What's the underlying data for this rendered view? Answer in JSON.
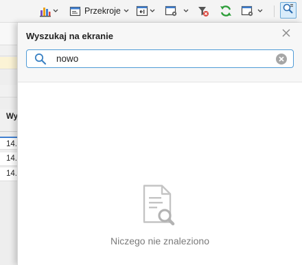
{
  "toolbar": {
    "przekroje_label": "Przekroje",
    "icons": [
      "chart-icon",
      "przekroje-icon",
      "layout-icon",
      "settings-window-icon",
      "filter-clear-icon",
      "refresh-icon",
      "settings-window-icon",
      "find-on-screen-icon"
    ]
  },
  "background": {
    "column_header": "Wy",
    "rows": [
      "14.",
      "14.",
      "14."
    ]
  },
  "search_panel": {
    "title": "Wyszukaj na ekranie",
    "search_value": "nowo",
    "empty_message": "Niczego nie znaleziono"
  },
  "colors": {
    "accent": "#4d9ad6",
    "refresh_green": "#2e9e3a",
    "filter_red": "#d9433a"
  }
}
